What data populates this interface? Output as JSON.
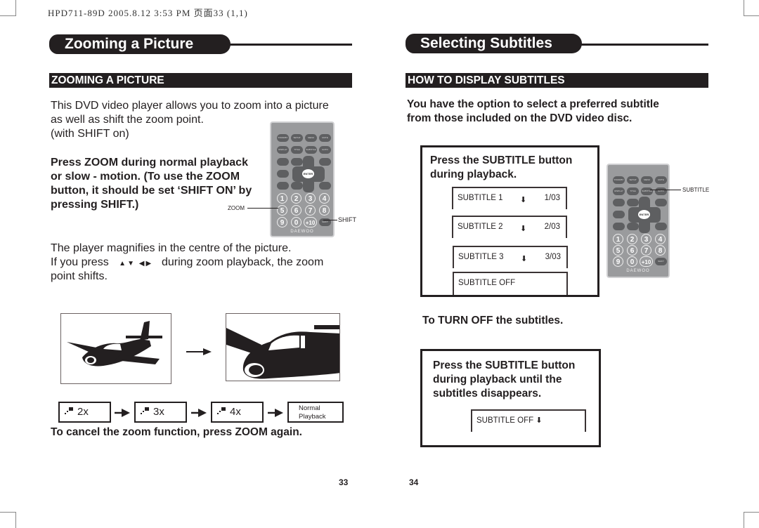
{
  "header_meta": "HPD711-89D  2005.8.12 3:53 PM  页面33 (1,1)",
  "left_page": {
    "title": "Zooming a Picture",
    "section_heading": "ZOOMING A PICTURE",
    "intro_lines": [
      "This DVD video player allows you to zoom into a picture",
      "as well as shift the zoom point.",
      "(with SHIFT on)"
    ],
    "instruction_lines": [
      "Press ZOOM during normal playback",
      "or slow - motion. (To use the ZOOM",
      "button, it should be set ‘SHIFT ON’ by",
      "pressing SHIFT.)"
    ],
    "remote_callouts": {
      "zoom": "ZOOM",
      "shift": "SHIFT"
    },
    "magnify_line": "The player magnifies in the centre of the picture.",
    "press_prefix": "If you press",
    "press_arrows": [
      "up-arrow",
      "down-arrow",
      "left-arrow",
      "right-arrow"
    ],
    "press_suffix": "during zoom playback, the zoom",
    "press_line3": "point shifts.",
    "zoom_steps": [
      "2x",
      "3x",
      "4x"
    ],
    "normal_playback": [
      "Normal",
      "Playback"
    ],
    "cancel_text": "To cancel the zoom function, press ZOOM again.",
    "page_number": "33"
  },
  "right_page": {
    "title": "Selecting Subtitles",
    "section_heading": "HOW TO DISPLAY SUBTITLES",
    "intro_lines": [
      "You have the option to select a preferred subtitle",
      "from those included on the DVD video disc."
    ],
    "box1_lines": [
      "Press the SUBTITLE button",
      "during playback."
    ],
    "subtitle_osd": [
      {
        "label": "SUBTITLE 1",
        "value": "1/03"
      },
      {
        "label": "SUBTITLE 2",
        "value": "2/03"
      },
      {
        "label": "SUBTITLE 3",
        "value": "3/03"
      },
      {
        "label": "SUBTITLE OFF",
        "value": ""
      }
    ],
    "remote_callout": "SUBTITLE",
    "turn_off_heading": "To TURN OFF the subtitles.",
    "box2_lines": [
      "Press the SUBTITLE button",
      "during playback until the",
      "subtitles disappears."
    ],
    "box2_osd": "SUBTITLE OFF",
    "page_number": "34"
  },
  "remote": {
    "row1": [
      "STANDBY",
      "SETUP",
      "MENU",
      "MUTE"
    ],
    "row2": [
      "DISPLAY",
      "TITLE",
      "SUBTITLE",
      "GOTO"
    ],
    "enter": "ENTER",
    "numbers": [
      "1",
      "2",
      "3",
      "4",
      "5",
      "6",
      "7",
      "8",
      "9",
      "0",
      "+10"
    ],
    "shift": "SHIFT",
    "brand": "DAEWOO"
  }
}
